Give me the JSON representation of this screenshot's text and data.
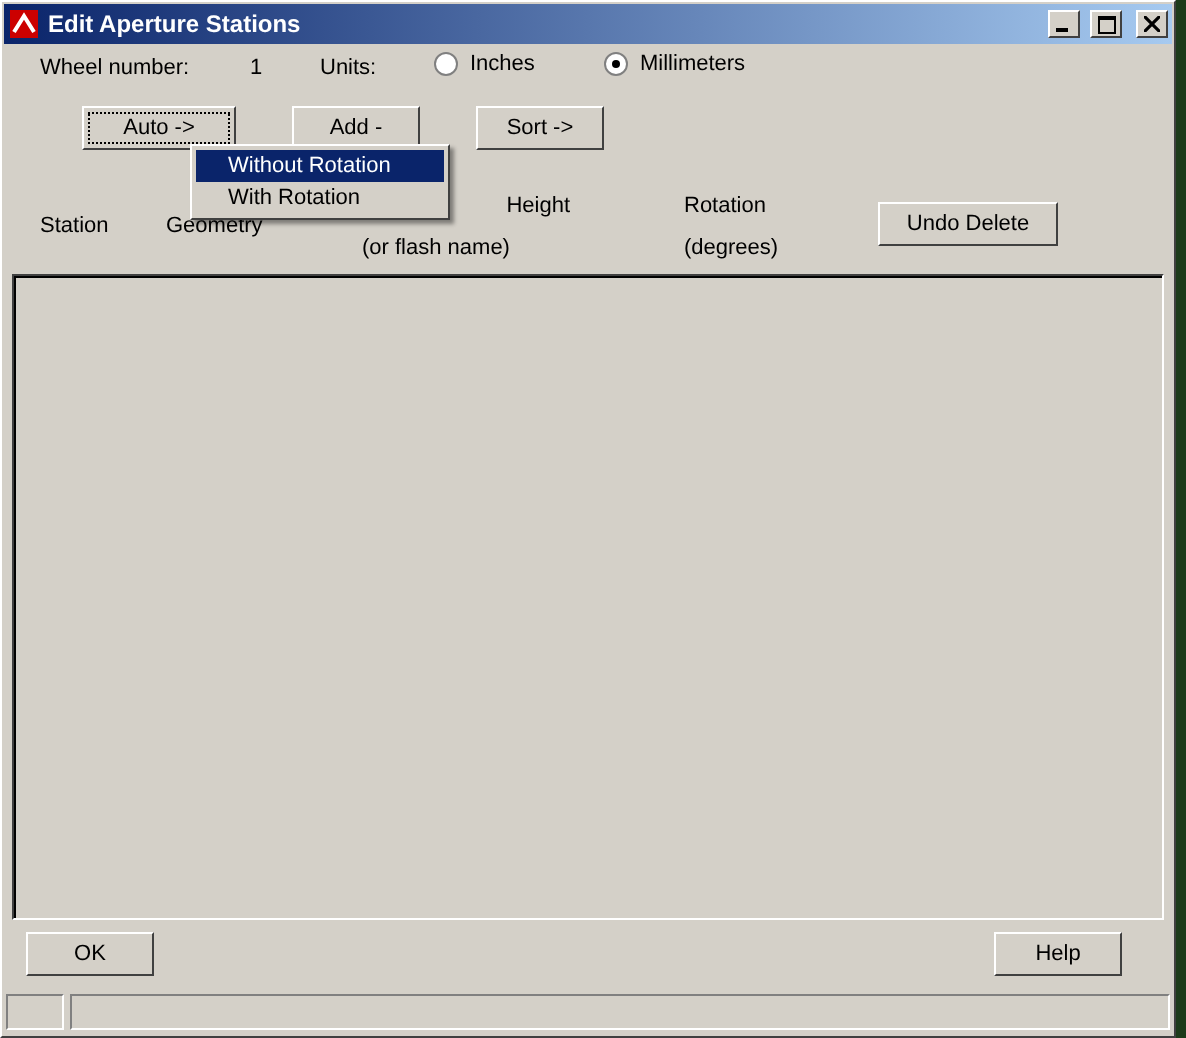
{
  "window": {
    "title": "Edit Aperture Stations"
  },
  "wheel": {
    "label": "Wheel number:",
    "value": "1"
  },
  "units": {
    "label": "Units:",
    "options": [
      {
        "label": "Inches",
        "selected": false
      },
      {
        "label": "Millimeters",
        "selected": true
      }
    ]
  },
  "buttons": [
    {
      "label": "Auto ->",
      "focused": true
    },
    {
      "label": "Add -",
      "focused": false
    },
    {
      "label": "Sort ->",
      "focused": false
    }
  ],
  "menu": {
    "items": [
      {
        "label": "Without Rotation",
        "selected": true
      },
      {
        "label": "With Rotation",
        "selected": false
      }
    ]
  },
  "columns": {
    "station": "Station",
    "geometry": "Geometry",
    "height": "Height",
    "rotation": "Rotation",
    "flash": "(or flash name)",
    "degrees": "(degrees)"
  },
  "undo_button": "Undo Delete",
  "ok_button": "OK",
  "help_button": "Help"
}
